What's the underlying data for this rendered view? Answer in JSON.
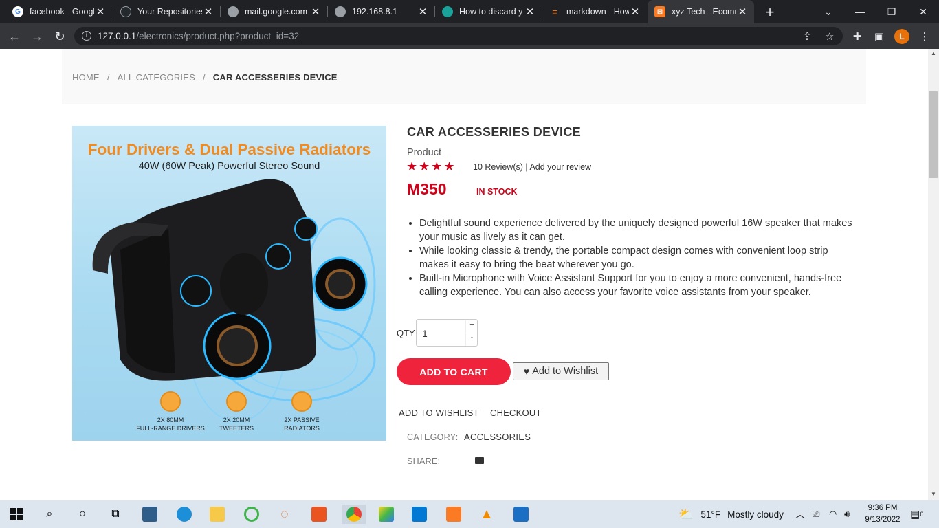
{
  "browser": {
    "tabs": [
      {
        "title": "facebook - Googl",
        "favicon": "google-icon",
        "color": "#4285f4"
      },
      {
        "title": "Your Repositories",
        "favicon": "github-icon",
        "color": "#24292e"
      },
      {
        "title": "mail.google.com",
        "favicon": "globe-icon",
        "color": "#9aa0a6"
      },
      {
        "title": "192.168.8.1",
        "favicon": "globe-icon",
        "color": "#9aa0a6"
      },
      {
        "title": "How to discard y",
        "favicon": "eye-icon",
        "color": "#1aa39a"
      },
      {
        "title": "markdown - How",
        "favicon": "stackoverflow-icon",
        "color": "#f48024"
      },
      {
        "title": "xyz Tech - Ecomm",
        "favicon": "xampp-icon",
        "color": "#fb7a24"
      }
    ],
    "url_host": "127.0.0.1",
    "url_path": "/electronics/product.php?product_id=32",
    "profile_initial": "L"
  },
  "breadcrumb": {
    "home": "HOME",
    "separator": "/",
    "all_categories": "ALL CATEGORIES",
    "current": "CAR ACCESSERIES DEVICE"
  },
  "image": {
    "headline": "Four Drivers & Dual Passive Radiators",
    "subline": "40W (60W Peak) Powerful Stereo Sound",
    "features": [
      {
        "line1": "2X 80MM",
        "line2": "FULL-RANGE DRIVERS"
      },
      {
        "line1": "2X 20MM",
        "line2": "TWEETERS"
      },
      {
        "line1": "2X PASSIVE",
        "line2": "RADIATORS"
      }
    ]
  },
  "product": {
    "title": "CAR ACCESSERIES DEVICE",
    "type": "Product",
    "rating": 4,
    "reviews_text": "10 Review(s) | Add your review",
    "price": "M350",
    "stock": "IN STOCK",
    "description": [
      "Delightful sound experience delivered by the uniquely designed powerful 16W speaker that makes your music as lively as it can get.",
      "While looking classic & trendy, the portable compact design comes with convenient loop strip makes it easy to bring the beat wherever you go.",
      "Built-in Microphone with Voice Assistant Support for you to enjoy a more convenient, hands-free calling experience. You can also access your favorite voice assistants from your speaker."
    ],
    "qty_label": "QTY",
    "qty_value": "1",
    "qty_plus": "+",
    "qty_minus": "-",
    "add_to_cart": "ADD TO CART",
    "add_to_wishlist_button": "Add to Wishlist",
    "link_wishlist": "ADD TO WISHLIST",
    "link_checkout": "CHECKOUT",
    "category_label": "CATEGORY:",
    "category_value": "ACCESSORIES",
    "share_label": "SHARE:"
  },
  "taskbar": {
    "weather_temp": "51°F",
    "weather_text": "Mostly cloudy",
    "time": "9:36 PM",
    "date": "9/13/2022",
    "notification_count": "6"
  },
  "colors": {
    "accent": "#ef233c",
    "price_red": "#d0021b",
    "headline_orange": "#f28a1e"
  }
}
